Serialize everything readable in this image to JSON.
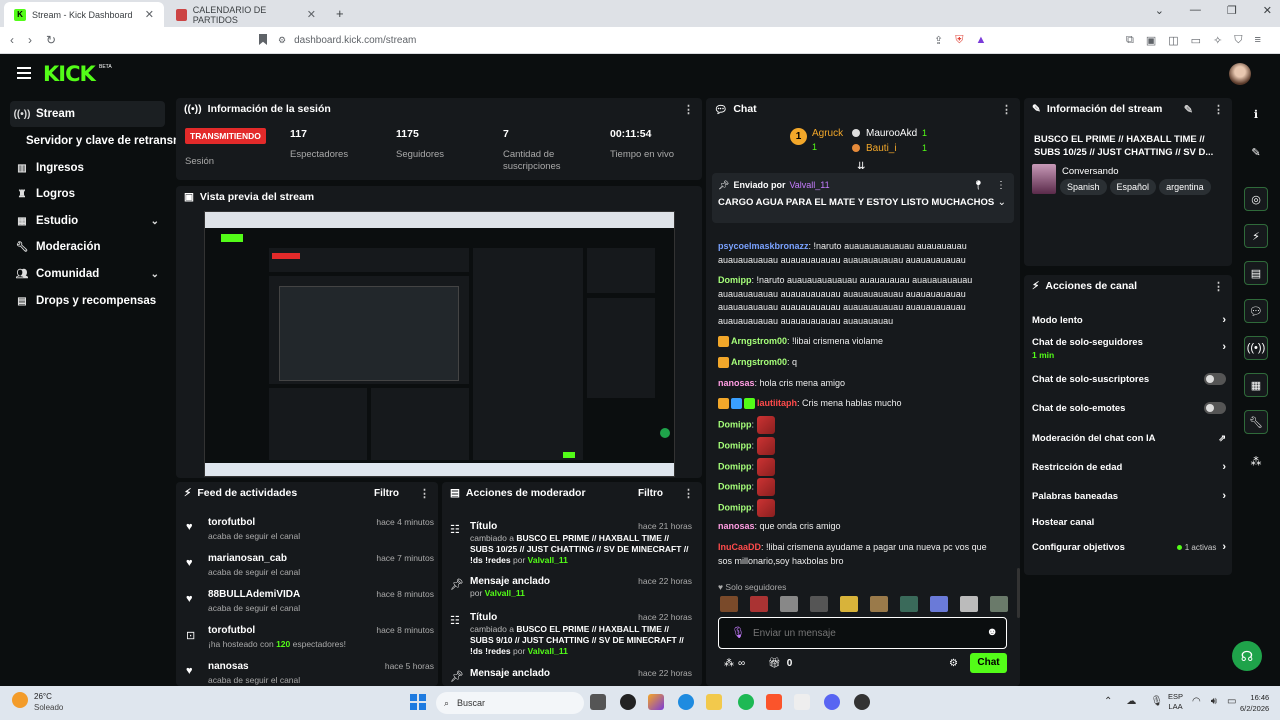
{
  "browser": {
    "tabs": [
      {
        "title": "Stream - Kick Dashboard"
      },
      {
        "title": "CALENDARIO DE PARTIDOS"
      }
    ],
    "new_tab": "+",
    "url": "dashboard.kick.com/stream"
  },
  "app": {
    "logo": "KICK",
    "logo_beta": "BETA"
  },
  "sidebar": {
    "items": [
      {
        "label": "Stream",
        "icon": "stream-icon"
      },
      {
        "label": "Servidor y clave de retransm",
        "icon": ""
      },
      {
        "label": "Ingresos",
        "icon": "chart-icon"
      },
      {
        "label": "Logros",
        "icon": "trophy-icon"
      },
      {
        "label": "Estudio",
        "icon": "studio-icon"
      },
      {
        "label": "Moderación",
        "icon": "wrench-icon"
      },
      {
        "label": "Comunidad",
        "icon": "people-icon"
      },
      {
        "label": "Drops y recompensas",
        "icon": "drops-icon"
      }
    ]
  },
  "session": {
    "title": "Información de la sesión",
    "status_badge": "TRANSMITIENDO",
    "status_label": "Sesión",
    "viewers": "117",
    "viewers_label": "Espectadores",
    "followers": "1175",
    "followers_label": "Seguidores",
    "subs": "7",
    "subs_label": "Cantidad de suscripciones",
    "uptime": "00:11:54",
    "uptime_label": "Tiempo en vivo"
  },
  "preview": {
    "title": "Vista previa del stream"
  },
  "feed": {
    "title": "Feed de actividades",
    "filter": "Filtro",
    "items": [
      {
        "icon": "heart-icon",
        "name": "torofutbol",
        "desc": "acaba de seguir el canal",
        "time": "hace 4 minutos"
      },
      {
        "icon": "heart-icon",
        "name": "marianosan_cab",
        "desc": "acaba de seguir el canal",
        "time": "hace 7 minutos"
      },
      {
        "icon": "heart-icon",
        "name": "88BULLAdemiVIDA",
        "desc": "acaba de seguir el canal",
        "time": "hace 8 minutos"
      },
      {
        "icon": "host-icon",
        "name": "torofutbol",
        "desc_prefix": "¡ha hosteado con ",
        "desc_count": "120",
        "desc_suffix": " espectadores!",
        "time": "hace 8 minutos"
      },
      {
        "icon": "heart-icon",
        "name": "nanosas",
        "desc": "acaba de seguir el canal",
        "time": "hace 5 horas"
      }
    ]
  },
  "modactions": {
    "title": "Acciones de moderador",
    "filter": "Filtro",
    "items": [
      {
        "icon": "title-icon",
        "name": "Título",
        "time": "hace 21 horas",
        "pre": "cambiado a ",
        "text": "BUSCO EL PRIME // HAXBALL TIME // SUBS 10/25 // JUST CHATTING // SV DE MINECRAFT // !ds !redes",
        "by": " por ",
        "user": "Valvall_11"
      },
      {
        "icon": "pin-icon",
        "name": "Mensaje anclado",
        "time": "hace 22 horas",
        "pre": "",
        "text": "",
        "by": "por ",
        "user": "Valvall_11"
      },
      {
        "icon": "title-icon",
        "name": "Título",
        "time": "hace 22 horas",
        "pre": "cambiado a ",
        "text": "BUSCO EL PRIME // HAXBALL TIME // SUBS 9/10 // JUST CHATTING // SV DE MINECRAFT // !ds !redes",
        "by": " por ",
        "user": "Valvall_11"
      },
      {
        "icon": "pin-icon",
        "name": "Mensaje anclado",
        "time": "hace 22 horas",
        "pre": "",
        "text": "",
        "by": "",
        "user": ""
      }
    ]
  },
  "chat": {
    "title": "Chat",
    "gifters": [
      {
        "rank": "1",
        "name": "Agruck",
        "count": "1"
      },
      {
        "name": "MaurooAkd",
        "count": "1"
      },
      {
        "name": "Bauti_i",
        "count": "1"
      }
    ],
    "pinned": {
      "label": "Enviado por",
      "user": "Valvall_11",
      "message": "CARGO AGUA PARA EL MATE Y ESTOY LISTO MUCHACHOS"
    },
    "messages": [
      {
        "user": "psycoelmaskbronazz",
        "color": "#7aa2ff",
        "text": ": !naruto auauauauauauau auauauauau auauauauauau auauauauauau auauauauauau auauauauauau"
      },
      {
        "user": "Domipp",
        "color": "#a6ff7a",
        "text": ": !naruto auauauauauauau auauauauau auauauauauau auauauauauau auauauauauau auauauauauau auauauauauau auauauauauau auauauauauau auauauauauau auauauauauau auauauauauau auauauauauau auauauauau"
      },
      {
        "user": "Arngstrom00",
        "color": "#a6ff7a",
        "text": ": !libai crismena violame"
      },
      {
        "user": "Arngstrom00",
        "color": "#a6ff7a",
        "text": ": q"
      },
      {
        "user": "nanosas",
        "color": "#ff9de2",
        "text": ": hola cris mena amigo"
      },
      {
        "user": "lautiitaph",
        "color": "#ff4b4b",
        "text": ": Cris mena hablas mucho"
      },
      {
        "user": "Domipp",
        "color": "#a6ff7a",
        "text": ":"
      },
      {
        "user": "Domipp",
        "color": "#a6ff7a",
        "text": ":"
      },
      {
        "user": "Domipp",
        "color": "#a6ff7a",
        "text": ":"
      },
      {
        "user": "Domipp",
        "color": "#a6ff7a",
        "text": ":"
      },
      {
        "user": "Domipp",
        "color": "#a6ff7a",
        "text": ":"
      },
      {
        "user": "nanosas",
        "color": "#ff9de2",
        "text": ": que onda cris amigo"
      },
      {
        "user": "InuCaaDD",
        "color": "#ff4b4b",
        "text": ": !libai crismena ayudame a pagar una nueva pc vos que sos millonario,soy haxbolas bro"
      }
    ],
    "followers_only": "Solo seguidores",
    "input_placeholder": "Enviar un mensaje",
    "points": "∞",
    "gifts": "0",
    "send": "Chat"
  },
  "stream_info": {
    "title": "Información del stream",
    "stream_title": "BUSCO EL PRIME // HAXBALL TIME // SUBS 10/25 // JUST CHATTING // SV D...",
    "category": "Conversando",
    "tags": [
      "Spanish",
      "Español",
      "argentina"
    ]
  },
  "channel_actions": {
    "title": "Acciones de canal",
    "rows": [
      {
        "label": "Modo lento",
        "control": "chevron"
      },
      {
        "label": "Chat de solo-seguidores",
        "sub": "1 min",
        "control": "chevron"
      },
      {
        "label": "Chat de solo-suscriptores",
        "control": "toggle"
      },
      {
        "label": "Chat de solo-emotes",
        "control": "toggle"
      },
      {
        "label": "Moderación del chat con IA",
        "control": "external"
      },
      {
        "label": "Restricción de edad",
        "control": "chevron"
      },
      {
        "label": "Palabras baneadas",
        "control": "chevron"
      },
      {
        "label": "Hostear canal",
        "control": "none"
      },
      {
        "label": "Configurar objetivos",
        "status": "1 activas",
        "control": "chevron"
      }
    ]
  },
  "taskbar": {
    "weather_temp": "26°C",
    "weather_desc": "Soleado",
    "search": "Buscar",
    "lang": "ESP",
    "lang2": "LAA",
    "time": "16:46",
    "date": "6/2/2026"
  },
  "colors": {
    "accent": "#53fc18",
    "live": "#e32a2a",
    "panel": "#16191c",
    "background": "#0b0e0f"
  }
}
